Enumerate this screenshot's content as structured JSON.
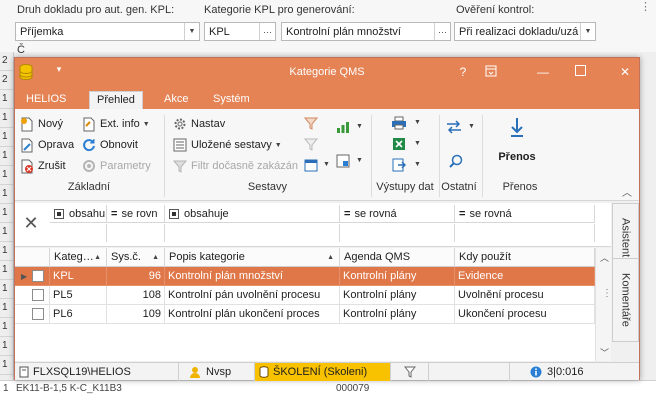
{
  "background_form": {
    "label_doc_type": "Druh dokladu pro aut. gen. KPL:",
    "label_category": "Kategorie KPL pro generování:",
    "label_verification": "Ověření kontrol:",
    "doc_type_value": "Příjemka",
    "category_code": "KPL",
    "category_name": "Kontrolní plán množství",
    "verification_value": "Při realizaci dokladu/uzá",
    "hidden_label_partial": "Č",
    "left_column_values": [
      "2",
      "2",
      "1",
      "1",
      "1",
      "1",
      "1",
      "1",
      "1",
      "1",
      "1",
      "1",
      "1",
      "1",
      "1",
      "1",
      "1"
    ],
    "bottom_row_text": "EK11-B-1,5 K-C_K11B3",
    "bottom_row_value": "000079"
  },
  "window": {
    "title": "Kategorie QMS",
    "help_label": "?",
    "tabs": [
      {
        "label": "HELIOS",
        "active": false
      },
      {
        "label": "Přehled",
        "active": true
      },
      {
        "label": "Akce",
        "active": false
      },
      {
        "label": "Systém",
        "active": false
      }
    ]
  },
  "ribbon": {
    "basic": {
      "group_label": "Základní",
      "new": "Nový",
      "ext_info": "Ext. info",
      "edit": "Oprava",
      "refresh": "Obnovit",
      "delete": "Zrušit",
      "params": "Parametry"
    },
    "sets": {
      "group_label": "Sestavy",
      "settings": "Nastav",
      "saved_sets": "Uložené sestavy",
      "temp_filter": "Filtr dočasně zakázán"
    },
    "outputs_label": "Výstupy dat",
    "other_label": "Ostatní",
    "transfers_label": "Přenos",
    "transfer_button": "Přenos"
  },
  "filter": {
    "operators": [
      "obsahu",
      "se rovn",
      "obsahuje",
      "se rovná",
      "se rovná"
    ]
  },
  "grid": {
    "columns": [
      {
        "label": "Kateg…",
        "sort": "▲"
      },
      {
        "label": "Sys.č.",
        "sort": "▲"
      },
      {
        "label": "Popis kategorie",
        "sort": "▲"
      },
      {
        "label": "Agenda QMS",
        "sort": ""
      },
      {
        "label": "Kdy použít",
        "sort": ""
      }
    ],
    "rows": [
      {
        "code": "KPL",
        "sys": "96",
        "desc": "Kontrolní plán množství",
        "agenda": "Kontrolní plány",
        "when": "Evidence",
        "selected": true
      },
      {
        "code": "PL5",
        "sys": "108",
        "desc": "Kontrolní pán uvolnění procesu",
        "agenda": "Kontrolní plány",
        "when": "Uvolnění procesu",
        "selected": false
      },
      {
        "code": "PL6",
        "sys": "109",
        "desc": "Kontrolní plán ukončení proces",
        "agenda": "Kontrolní plány",
        "when": "Ukončení procesu",
        "selected": false
      }
    ]
  },
  "side_tabs": [
    "Asistent",
    "Komentáře"
  ],
  "status": {
    "server": "FLXSQL19\\HELIOS",
    "user": "Nvsp",
    "database": "ŠKOLENÍ (Skoleni)",
    "counter": "3|0:016"
  },
  "colors": {
    "accent": "#e58355",
    "selected_row": "#e07748",
    "db_highlight": "#f9c200"
  }
}
